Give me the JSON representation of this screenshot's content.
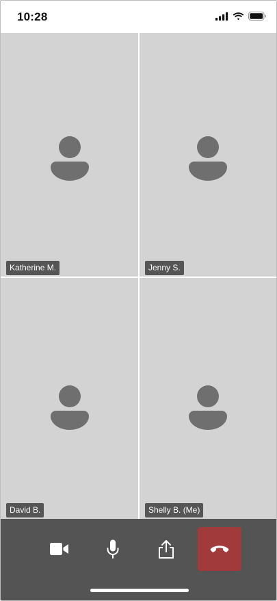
{
  "status_bar": {
    "time": "10:28",
    "icons": [
      "cellular-signal-icon",
      "wifi-icon",
      "battery-icon"
    ]
  },
  "participants": [
    {
      "name": "Katherine M.",
      "icon": "person-avatar-icon"
    },
    {
      "name": "Jenny S.",
      "icon": "person-avatar-icon"
    },
    {
      "name": "David B.",
      "icon": "person-avatar-icon"
    },
    {
      "name": "Shelly B. (Me)",
      "icon": "person-avatar-icon"
    }
  ],
  "toolbar": {
    "buttons": [
      {
        "icon": "video-camera-icon"
      },
      {
        "icon": "microphone-icon"
      },
      {
        "icon": "share-icon"
      },
      {
        "icon": "end-call-icon"
      }
    ]
  },
  "colors": {
    "tile_background": "#d4d3d3",
    "avatar": "#6f6f6f",
    "name_tag": "#555555",
    "toolbar": "#545454",
    "end_call": "#a13b3b"
  }
}
